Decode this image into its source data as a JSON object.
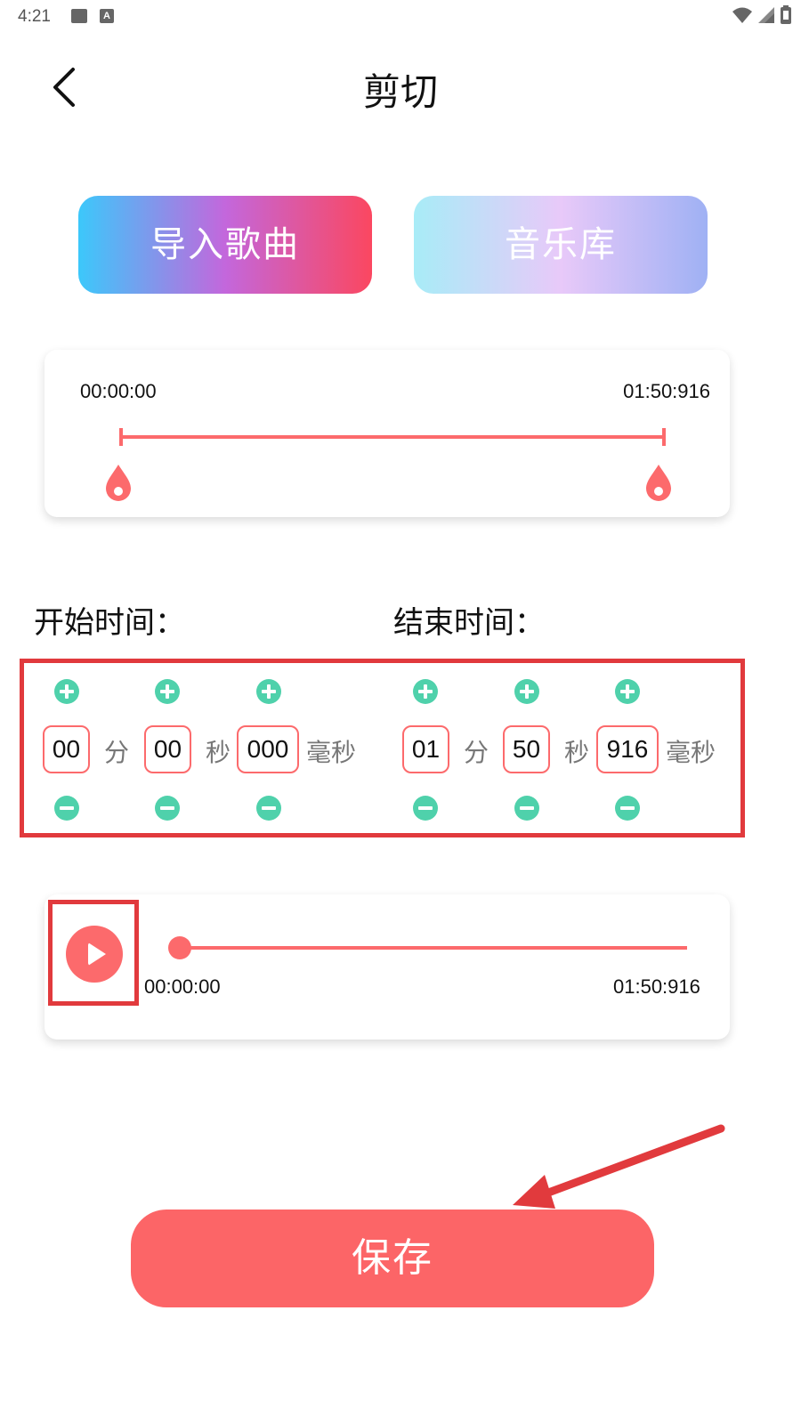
{
  "status_bar": {
    "time": "4:21",
    "left_icons": [
      "image-icon",
      "a-icon"
    ],
    "right_icons": [
      "wifi-icon",
      "signal-icon",
      "battery-icon"
    ],
    "a_icon_glyph": "A"
  },
  "header": {
    "back_icon": "chevron-left-icon",
    "title": "剪切"
  },
  "source_buttons": {
    "import_label": "导入歌曲",
    "library_label": "音乐库"
  },
  "range": {
    "start_time": "00:00:00",
    "end_time": "01:50:916",
    "handle_icon": "drop-handle-icon"
  },
  "start_time": {
    "label": "开始时间：",
    "minutes": "00",
    "seconds": "00",
    "milliseconds": "000"
  },
  "end_time": {
    "label": "结束时间：",
    "minutes": "01",
    "seconds": "50",
    "milliseconds": "916"
  },
  "units": {
    "minutes": "分",
    "seconds": "秒",
    "milliseconds": "毫秒"
  },
  "player": {
    "current_time": "00:00:00",
    "total_time": "01:50:916",
    "progress": 0
  },
  "save_label": "保存",
  "colors": {
    "accent": "#fc6a6c",
    "stepper": "#4fd1ab",
    "highlight": "#e13a3d",
    "import_gradient": [
      "#3cc8fb",
      "#c367dc",
      "#fb4760"
    ],
    "library_gradient": [
      "#a8ecf7",
      "#e8c9f9",
      "#9fb1f4"
    ]
  }
}
